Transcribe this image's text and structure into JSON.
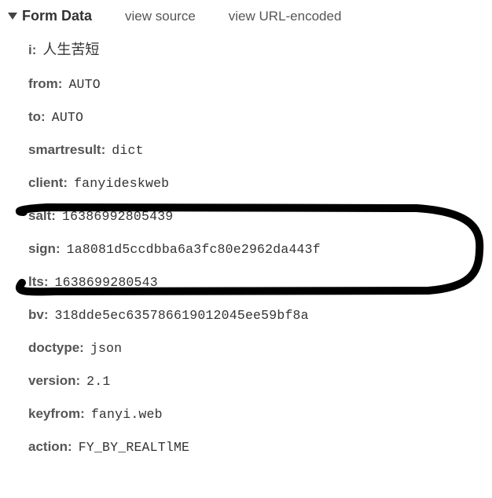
{
  "header": {
    "title": "Form Data",
    "view_source": "view source",
    "view_url_encoded": "view URL-encoded"
  },
  "fields": [
    {
      "key": "i:",
      "value": "人生苦短",
      "style": "cjk"
    },
    {
      "key": "from:",
      "value": "AUTO",
      "style": "mono"
    },
    {
      "key": "to:",
      "value": "AUTO",
      "style": "mono"
    },
    {
      "key": "smartresult:",
      "value": "dict",
      "style": "mono"
    },
    {
      "key": "client:",
      "value": "fanyideskweb",
      "style": "mono"
    },
    {
      "key": "salt:",
      "value": "16386992805439",
      "style": "mono"
    },
    {
      "key": "sign:",
      "value": "1a8081d5ccdbba6a3fc80e2962da443f",
      "style": "mono"
    },
    {
      "key": "lts:",
      "value": "1638699280543",
      "style": "mono"
    },
    {
      "key": "bv:",
      "value": "318dde5ec635786619012045ee59bf8a",
      "style": "mono"
    },
    {
      "key": "doctype:",
      "value": "json",
      "style": "mono"
    },
    {
      "key": "version:",
      "value": "2.1",
      "style": "mono"
    },
    {
      "key": "keyfrom:",
      "value": "fanyi.web",
      "style": "mono"
    },
    {
      "key": "action:",
      "value": "FY_BY_REALTlME",
      "style": "mono"
    }
  ]
}
